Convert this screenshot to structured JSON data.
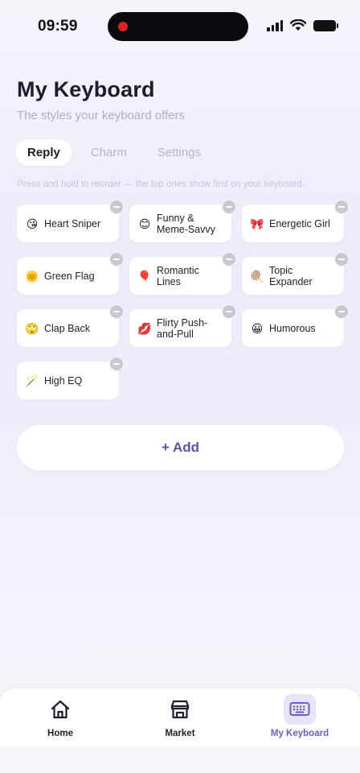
{
  "status_bar": {
    "time": "09:59",
    "icons": [
      "recording-dot-icon",
      "signal-icon",
      "wifi-icon",
      "battery-icon"
    ]
  },
  "header": {
    "title": "My Keyboard",
    "subtitle": "The styles your keyboard offers"
  },
  "tabs": [
    {
      "label": "Reply",
      "active": true
    },
    {
      "label": "Charm",
      "active": false
    },
    {
      "label": "Settings",
      "active": false
    }
  ],
  "hint": "Press and hold to reorder — the top ones show first on your keyboard.",
  "styles": [
    {
      "emoji": "😘",
      "label": "Heart Sniper"
    },
    {
      "emoji": "😊",
      "label": "Funny & Meme-Savvy"
    },
    {
      "emoji": "🎀",
      "label": "Energetic Girl"
    },
    {
      "emoji": "🌞",
      "label": "Green Flag"
    },
    {
      "emoji": "🎈",
      "label": "Romantic Lines"
    },
    {
      "emoji": "🍭",
      "label": "Topic Expander"
    },
    {
      "emoji": "🙄",
      "label": "Clap Back"
    },
    {
      "emoji": "💋",
      "label": "Flirty Push-and-Pull"
    },
    {
      "emoji": "😀",
      "label": "Humorous"
    },
    {
      "emoji": "🪄",
      "label": "High EQ"
    }
  ],
  "add_button": {
    "label": "+ Add"
  },
  "bottom_nav": [
    {
      "label": "Home",
      "icon": "home-icon",
      "active": false
    },
    {
      "label": "Market",
      "icon": "store-icon",
      "active": false
    },
    {
      "label": "My Keyboard",
      "icon": "keyboard-icon",
      "active": true
    }
  ],
  "colors": {
    "accent": "#6c5cc5",
    "add_text": "#5c4fb0",
    "active_nav_bg": "#e8e2fa",
    "remove_badge": "#c9c7cf",
    "record_dot": "#e02020"
  }
}
